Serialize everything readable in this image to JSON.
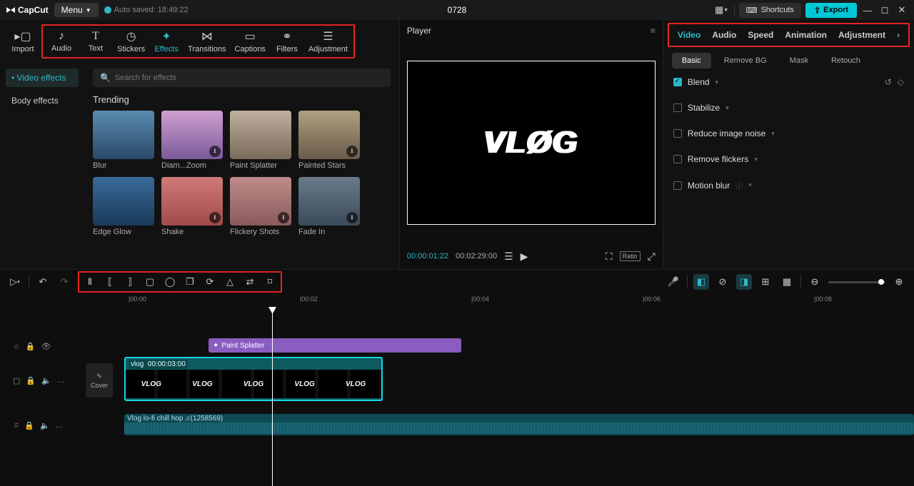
{
  "titlebar": {
    "logo": "CapCut",
    "menu": "Menu",
    "auto_saved": "Auto saved: 18:49:22",
    "project_title": "0728",
    "shortcuts": "Shortcuts",
    "export": "Export"
  },
  "top_tools": [
    {
      "label": "Import",
      "icon": "⇥",
      "active": false
    },
    {
      "label": "Audio",
      "icon": "♪",
      "active": false
    },
    {
      "label": "Text",
      "icon": "T",
      "active": false
    },
    {
      "label": "Stickers",
      "icon": "◷",
      "active": false
    },
    {
      "label": "Effects",
      "icon": "✦",
      "active": true
    },
    {
      "label": "Transitions",
      "icon": "⋈",
      "active": false
    },
    {
      "label": "Captions",
      "icon": "▭",
      "active": false
    },
    {
      "label": "Filters",
      "icon": "⚭",
      "active": false
    },
    {
      "label": "Adjustment",
      "icon": "⚙",
      "active": false
    }
  ],
  "effects_subnav": [
    {
      "label": "Video effects",
      "active": true
    },
    {
      "label": "Body effects",
      "active": false
    }
  ],
  "search_placeholder": "Search for effects",
  "trending_title": "Trending",
  "effects": [
    {
      "label": "Blur"
    },
    {
      "label": "Diam...Zoom"
    },
    {
      "label": "Paint Splatter"
    },
    {
      "label": "Painted Stars"
    },
    {
      "label": "Edge Glow"
    },
    {
      "label": "Shake"
    },
    {
      "label": "Flickery Shots"
    },
    {
      "label": "Fade In"
    }
  ],
  "player": {
    "title": "Player",
    "vlog_text": "VLØG",
    "time_current": "00:00:01:22",
    "time_duration": "00:02:29:00",
    "ratio": "Ratio"
  },
  "inspector": {
    "tabs": [
      "Video",
      "Audio",
      "Speed",
      "Animation",
      "Adjustment"
    ],
    "active_tab": "Video",
    "subtabs": [
      "Basic",
      "Remove BG",
      "Mask",
      "Retouch"
    ],
    "active_subtab": "Basic",
    "rows": [
      {
        "label": "Blend",
        "checked": true,
        "expandable": true,
        "reset": true
      },
      {
        "label": "Stabilize",
        "checked": false,
        "expandable": true
      },
      {
        "label": "Reduce image noise",
        "checked": false,
        "expandable": true
      },
      {
        "label": "Remove flickers",
        "checked": false,
        "expandable": true
      },
      {
        "label": "Motion blur",
        "checked": false,
        "expandable": true,
        "info": true
      }
    ]
  },
  "timeline": {
    "marks": [
      {
        "label": "|00:00",
        "pos": 15
      },
      {
        "label": "|00:02",
        "pos": 255
      },
      {
        "label": "|00:04",
        "pos": 495
      },
      {
        "label": "|00:06",
        "pos": 735
      },
      {
        "label": "|00:08",
        "pos": 975
      }
    ],
    "cover": "Cover",
    "fx_clip": "Paint Splatter",
    "vid_clip": {
      "name": "vlog",
      "duration": "00:00:03:00"
    },
    "aud_clip": "Vlog  lo-fi chill hop ♫(1258569)"
  }
}
